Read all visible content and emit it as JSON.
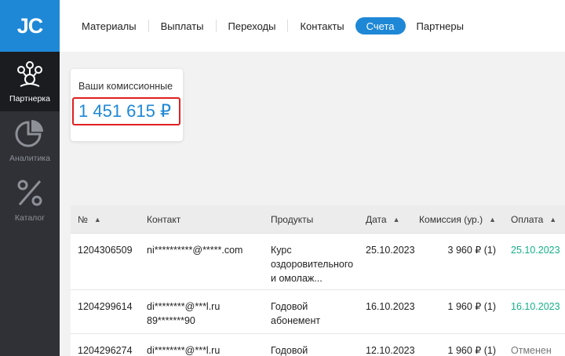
{
  "logo": "JC",
  "sidebar": {
    "items": [
      {
        "label": "Партнерка",
        "icon": "partners-icon"
      },
      {
        "label": "Аналитика",
        "icon": "pie-chart-icon"
      },
      {
        "label": "Каталог",
        "icon": "percent-icon"
      }
    ]
  },
  "tabs": [
    "Материалы",
    "Выплаты",
    "Переходы",
    "Контакты",
    "Счета",
    "Партнеры"
  ],
  "active_tab": "Счета",
  "commission": {
    "label": "Ваши комиссионные",
    "value": "1 451 615 ₽"
  },
  "table": {
    "headers": [
      "№",
      "Контакт",
      "Продукты",
      "Дата",
      "Комиссия (ур.)",
      "Оплата"
    ],
    "rows": [
      {
        "id": "1204306509",
        "contact": "ni**********@*****.com",
        "product": "Курс оздоровительного и омолаж...",
        "date": "25.10.2023",
        "commission": "3 960 ₽ (1)",
        "payment": "25.10.2023"
      },
      {
        "id": "1204299614",
        "contact": "di********@***l.ru 89*******90",
        "product": "Годовой абонемент",
        "date": "16.10.2023",
        "commission": "1 960 ₽ (1)",
        "payment": "16.10.2023"
      },
      {
        "id": "1204296274",
        "contact": "di********@***l.ru",
        "product": "Годовой",
        "date": "12.10.2023",
        "commission": "1 960 ₽ (1)",
        "payment": "Отменен"
      }
    ]
  },
  "colors": {
    "accent": "#1e88d6",
    "paid": "#14b087",
    "highlight_border": "#e02020"
  }
}
